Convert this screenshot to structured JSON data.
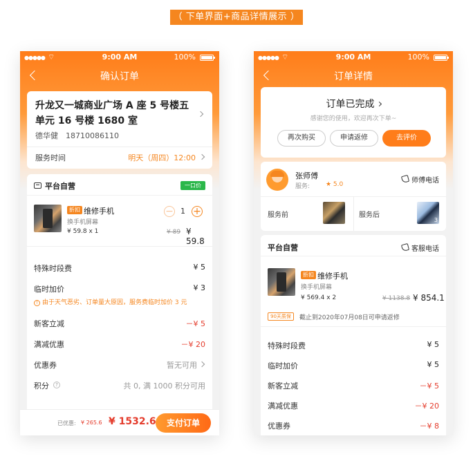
{
  "banner": "（ 下单界面+商品详情展示 ）",
  "statusbar": {
    "time": "9:00 AM",
    "battery": "100%",
    "signal": "●●●●●",
    "wifi": "⌔"
  },
  "left": {
    "title": "确认订单",
    "address": "升龙又一城商业广场 A 座 5 号楼五单元 16 号楼 1680 室",
    "contact": "德华健　18710086110",
    "service_time_label": "服务时间",
    "service_time_value": "明天（周四）12:00",
    "store_name": "平台自营",
    "price_badge": "一口价",
    "product": {
      "tag": "折扣",
      "name": "维修手机",
      "sub": "换手机屏幕",
      "unit_price": "¥ 59.8 x 1",
      "orig_price": "¥ 89",
      "price": "¥ 59.8",
      "quantity": "1",
      "minus": "−",
      "plus": "+"
    },
    "rows": [
      {
        "label": "特殊时段费",
        "value": "¥ 5"
      },
      {
        "label": "临时加价",
        "value": "¥ 3"
      },
      {
        "label": "新客立减",
        "value": "－¥ 5"
      },
      {
        "label": "满减优惠",
        "value": "－¥ 20"
      },
      {
        "label": "优惠券",
        "value": "暂无可用"
      },
      {
        "label": "积分",
        "value": "共 0, 满 1000 积分可用"
      }
    ],
    "note": "由于天气恶劣、订单量大原因，服务费临时加价 3 元",
    "note_icon": "!",
    "help_icon": "?",
    "footer": {
      "saved_label": "已优惠:",
      "saved_amount": "¥ 265.6",
      "total": "¥ 1532.6",
      "pay_label": "支付订单"
    }
  },
  "right": {
    "title": "订单详情",
    "status_title": "订单已完成",
    "status_sub": "感谢您的使用，欢迎再次下单~",
    "buttons": [
      "再次购买",
      "申请返修",
      "去评价"
    ],
    "worker": {
      "name": "张师傅",
      "score_label": "服务:",
      "score": "★ 5.0",
      "call_label": "师傅电话",
      "before_label": "服务前",
      "after_label": "服务后",
      "after_count": "3"
    },
    "store_name": "平台自营",
    "service_call_label": "客服电话",
    "product": {
      "tag": "折扣",
      "name": "维修手机",
      "sub": "换手机屏幕",
      "unit_price": "¥ 569.4 x 2",
      "orig_price": "¥ 1138.8",
      "price": "¥ 854.1"
    },
    "warranty_badge": "90天质保",
    "warranty_text": "截止到2020年07月08日可申请返修",
    "rows": [
      {
        "label": "特殊时段费",
        "value": "¥ 5"
      },
      {
        "label": "临时加价",
        "value": "¥ 5"
      },
      {
        "label": "新客立减",
        "value": "－¥ 5"
      },
      {
        "label": "满减优惠",
        "value": "－¥ 20"
      },
      {
        "label": "优惠券",
        "value": "－¥ 8"
      }
    ]
  },
  "colors": {
    "accent": "#f5861f",
    "red": "#e43b2b",
    "green": "#2bb74a"
  }
}
